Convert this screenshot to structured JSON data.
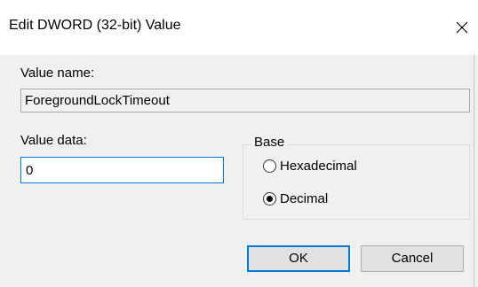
{
  "window": {
    "title": "Edit DWORD (32-bit) Value",
    "close_icon": "close-icon"
  },
  "value_name": {
    "label": "Value name:",
    "value": "ForegroundLockTimeout"
  },
  "value_data": {
    "label": "Value data:",
    "value": "0"
  },
  "base": {
    "legend": "Base",
    "options": [
      {
        "label": "Hexadecimal",
        "selected": false
      },
      {
        "label": "Decimal",
        "selected": true
      }
    ]
  },
  "buttons": {
    "ok_label": "OK",
    "cancel_label": "Cancel"
  },
  "colors": {
    "accent": "#0078d7",
    "dialog_bg": "#f0f0f0"
  }
}
